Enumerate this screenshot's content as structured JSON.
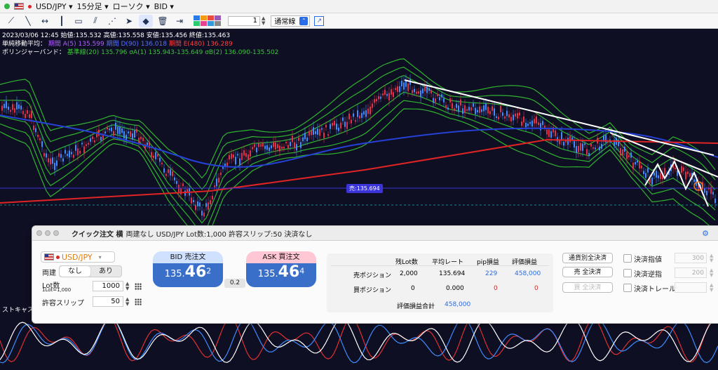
{
  "topbar": {
    "symbol": "USD/JPY",
    "timeframe": "15分足",
    "chart_type": "ローソク",
    "price_type": "BID"
  },
  "toolbar": {
    "tools": [
      "trendline-icon",
      "line-icon",
      "horizontal-line-icon",
      "vertical-line-icon",
      "rectangle-icon",
      "channel-icon",
      "fibonacci-icon",
      "cursor-icon",
      "eraser-icon",
      "trash-icon",
      "measure-icon"
    ],
    "palette": [
      "#2c7be5",
      "#f39c12",
      "#e74c3c",
      "#9b59b6",
      "#2ecc71",
      "#e84393",
      "#3498db",
      "#888888"
    ],
    "line_width": "1",
    "line_style": "通常線"
  },
  "info": {
    "ohlc": "2023/03/06 12:45  始値:135.532  高値:135.558  安値:135.456  終値:135.463",
    "ma_label": "単純移動平均：",
    "ma_a": "期間 A(5) 135.599",
    "ma_d": "期間 D(90) 136.018",
    "ma_e": "期間 E(480) 136.289",
    "bb_label": "ボリンジャーバンド：",
    "bb_values": "基準線(20) 135.796  σA(1) 135.943-135.649  σB(2) 136.090-135.502"
  },
  "chart": {
    "price_tag": "売:135.694",
    "stoch_label": "ストキャス"
  },
  "colors": {
    "ma_a": "#b05cff",
    "ma_d": "#2541d6",
    "ma_e": "#e02424",
    "bb": "#2fb32f",
    "up": "#3f8cff",
    "down": "#e0304a"
  },
  "panel": {
    "title_bold": "クイック注文 横",
    "title_rest": "両建なし USD/JPY Lot数:1,000 許容スリップ:50 決済なし",
    "pair": "USD/JPY",
    "hedge_label": "両建",
    "hedge_options": [
      "なし",
      "あり"
    ],
    "lot_label": "Lot数",
    "lot_sub": "1Lot=1,000",
    "lot_value": "1000",
    "slip_label": "許容スリップ",
    "slip_value": "50",
    "bid": {
      "label": "BID 売注文",
      "prefix": "135.",
      "big": "46",
      "sup": "2"
    },
    "ask": {
      "label": "ASK 買注文",
      "prefix": "135.",
      "big": "46",
      "sup": "4"
    },
    "spread": "0.2",
    "positions": {
      "headers": [
        "残Lot数",
        "平均レート",
        "pip損益",
        "評価損益"
      ],
      "sell": {
        "label": "売ポジション",
        "lots": "2,000",
        "avg": "135.694",
        "pip": "229",
        "pl": "458,000"
      },
      "buy": {
        "label": "買ポジション",
        "lots": "0",
        "avg": "0.000",
        "pip": "0",
        "pl": "0"
      },
      "total_label": "評価損益合計",
      "total": "458,000"
    },
    "buttons": [
      "通貨別全決済",
      "売 全決済",
      "買 全決済"
    ],
    "settle": [
      {
        "label": "決済指値",
        "value": "300"
      },
      {
        "label": "決済逆指",
        "value": "200"
      },
      {
        "label": "決済トレール",
        "value": ""
      }
    ]
  }
}
